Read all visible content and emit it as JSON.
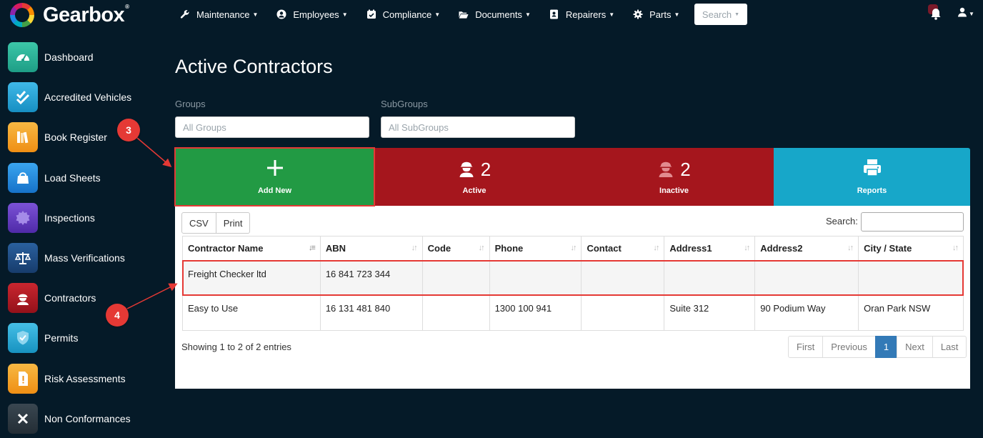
{
  "brand": {
    "name": "Gearbox",
    "reg": "®"
  },
  "nav": [
    {
      "label": "Maintenance",
      "icon": "wrench-icon"
    },
    {
      "label": "Employees",
      "icon": "user-circle-icon"
    },
    {
      "label": "Compliance",
      "icon": "calendar-check-icon"
    },
    {
      "label": "Documents",
      "icon": "folder-open-icon"
    },
    {
      "label": "Repairers",
      "icon": "address-book-icon"
    },
    {
      "label": "Parts",
      "icon": "gear-icon"
    }
  ],
  "search_dropdown": {
    "label": "Search"
  },
  "sidebar": {
    "items": [
      {
        "label": "Dashboard",
        "icon": "speedometer-icon",
        "color": "#2bb59a"
      },
      {
        "label": "Accredited Vehicles",
        "icon": "double-check-icon",
        "color": "#1ba3d4"
      },
      {
        "label": "Book Register",
        "icon": "books-icon",
        "color": "#f5a623"
      },
      {
        "label": "Load Sheets",
        "icon": "bag-icon",
        "color": "#1e8fe0"
      },
      {
        "label": "Inspections",
        "icon": "badge-icon",
        "color": "#6a3fc7"
      },
      {
        "label": "Mass Verifications",
        "icon": "scales-icon",
        "color": "#1e4f8a"
      },
      {
        "label": "Contractors",
        "icon": "hardhat-worker-icon",
        "color": "#b81c25"
      },
      {
        "label": "Permits",
        "icon": "shield-check-icon",
        "color": "#2aa9d6"
      },
      {
        "label": "Risk Assessments",
        "icon": "warning-doc-icon",
        "color": "#f5a623"
      },
      {
        "label": "Non Conformances",
        "icon": "x-icon",
        "color": "#2e3942"
      }
    ]
  },
  "page": {
    "title": "Active Contractors"
  },
  "filters": {
    "groups": {
      "label": "Groups",
      "placeholder": "All Groups"
    },
    "subgroups": {
      "label": "SubGroups",
      "placeholder": "All SubGroups"
    }
  },
  "tiles": [
    {
      "key": "add",
      "label": "Add New",
      "count": "",
      "icon": "plus-icon",
      "color": "#229a44"
    },
    {
      "key": "active",
      "label": "Active",
      "count": "2",
      "icon": "hardhat-worker-icon",
      "color": "#a5161d"
    },
    {
      "key": "inactive",
      "label": "Inactive",
      "count": "2",
      "icon": "hardhat-worker-icon",
      "color": "#a5161d"
    },
    {
      "key": "reports",
      "label": "Reports",
      "count": "",
      "icon": "printer-icon",
      "color": "#17a7c9"
    }
  ],
  "table": {
    "buttons": {
      "csv": "CSV",
      "print": "Print"
    },
    "search_label": "Search:",
    "columns": [
      "Contractor Name",
      "ABN",
      "Code",
      "Phone",
      "Contact",
      "Address1",
      "Address2",
      "City / State"
    ],
    "rows": [
      [
        "Freight Checker ltd",
        "16 841 723 344",
        "",
        "",
        "",
        "",
        "",
        ""
      ],
      [
        "Easy to Use",
        "16 131 481 840",
        "",
        "1300 100 941",
        "",
        "Suite 312",
        "90 Podium Way",
        "Oran Park NSW"
      ]
    ],
    "info": "Showing 1 to 2 of 2 entries",
    "pagination": {
      "first": "First",
      "previous": "Previous",
      "current": "1",
      "next": "Next",
      "last": "Last"
    }
  },
  "annotations": {
    "marker_3": "3",
    "marker_4": "4",
    "color": "#e53935"
  }
}
